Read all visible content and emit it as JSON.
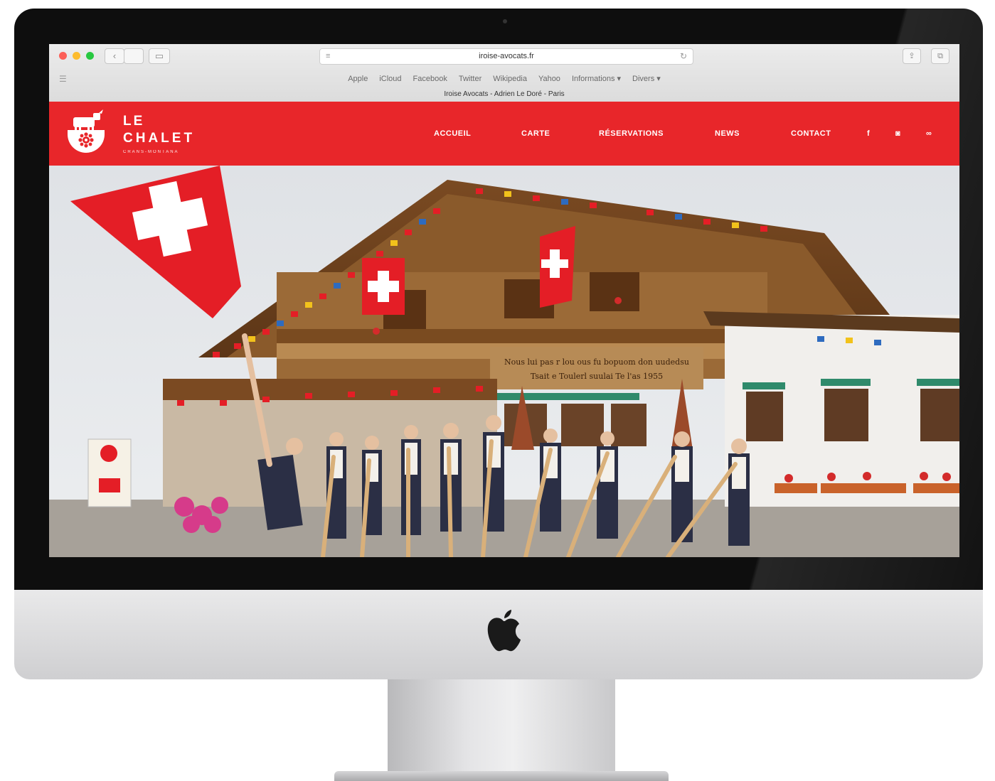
{
  "browser": {
    "url": "iroise-avocats.fr",
    "bookmarks": [
      "Apple",
      "iCloud",
      "Facebook",
      "Twitter",
      "Wikipedia",
      "Yahoo",
      "Informations ▾",
      "Divers ▾"
    ],
    "tab_title": "Iroise Avocats - Adrien Le Doré - Paris"
  },
  "site": {
    "logo": {
      "le": "LE",
      "chalet": "CHALET",
      "tagline": "CRANS-MONTANA"
    },
    "nav": [
      "ACCUEIL",
      "CARTE",
      "RÉSERVATIONS",
      "NEWS",
      "CONTACT"
    ],
    "social": [
      {
        "icon": "facebook-icon",
        "glyph": "f"
      },
      {
        "icon": "instagram-icon",
        "glyph": "◙"
      },
      {
        "icon": "tripadvisor-icon",
        "glyph": "∞"
      }
    ]
  },
  "hero": {
    "building_sign_line1": "Nous lui pas r lou ous fu bopuom don uudedsu",
    "building_sign_line2": "Tsait e Toulerl suulai Te l'as 1955"
  },
  "colors": {
    "brand_red": "#e8262a",
    "wood": "#8a5a2b",
    "sky": "#e5e7ea"
  }
}
